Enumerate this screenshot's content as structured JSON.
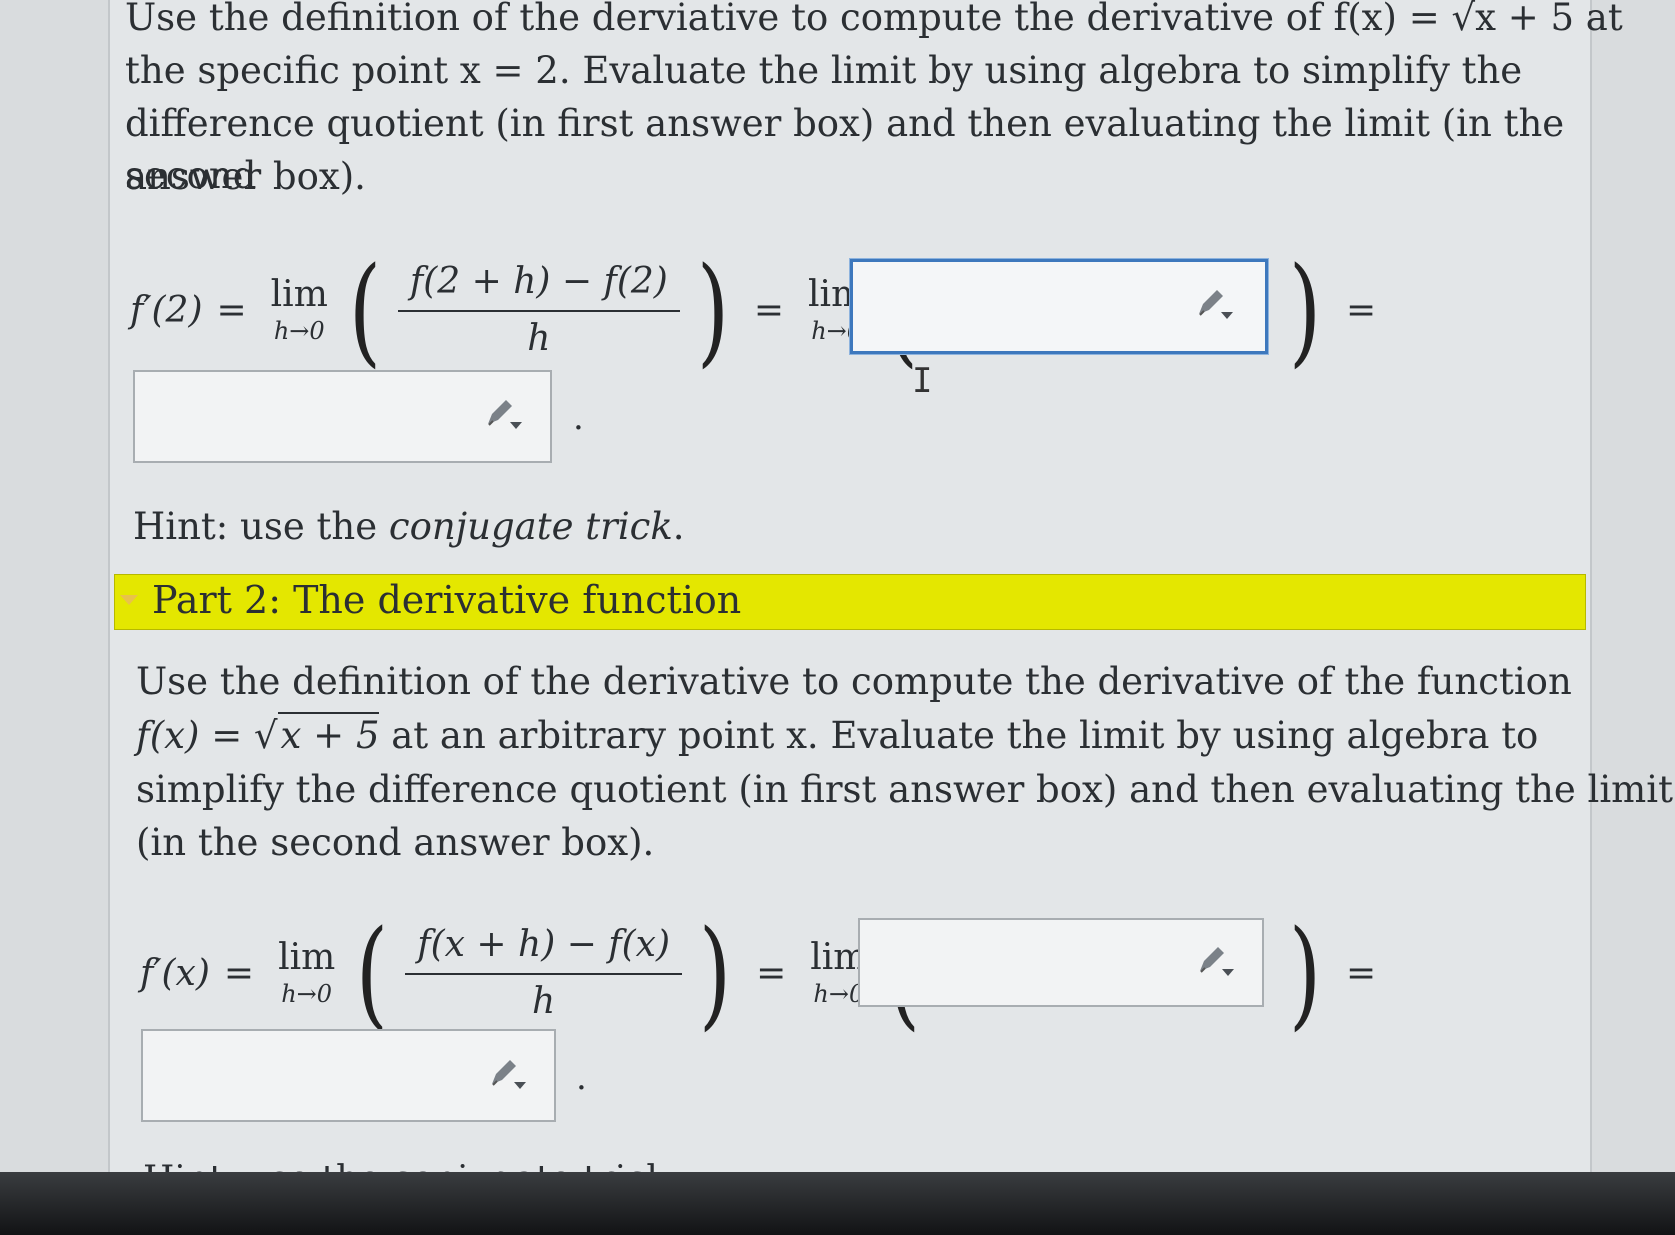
{
  "part1": {
    "para_lines": [
      "Use the definition of the derviative to compute the derivative of f(x) = √x + 5 at",
      "the specific point x = 2. Evaluate the limit by using algebra to simplify the",
      "difference quotient (in first answer box) and then evaluating the limit (in the second",
      "answer box)."
    ],
    "lhs": "f′(2)",
    "eq": "=",
    "lim": "lim",
    "sub": "h→0",
    "numerator": "f(2 + h) − f(2)",
    "denominator": "h",
    "end_period": ".",
    "hint_prefix": "Hint: use the ",
    "hint_emph": "conjugate trick",
    "hint_suffix": "."
  },
  "section2": {
    "title": "Part 2: The derivative function"
  },
  "part2": {
    "line1": "Use the definition of the derivative to compute the derivative of the function",
    "line2_fx": "f(x) = ",
    "line2_radicand": "x + 5",
    "line2_rest": " at an arbitrary point x. Evaluate the limit by using algebra to",
    "line3": "simplify the difference quotient (in first answer box) and then evaluating the limit",
    "line4": "(in the second answer box).",
    "lhs": "f′(x)",
    "eq": "=",
    "lim": "lim",
    "sub": "h→0",
    "numerator": "f(x + h) − f(x)",
    "denominator": "h",
    "end_period": ".",
    "cut_hint": "Hint: use the conjugate trick"
  },
  "icons": {
    "pencil": "pencil-dropdown-icon",
    "cursor": "text-cursor-icon"
  },
  "colors": {
    "section_bar": "#e4e700",
    "active_border": "#3d78bd"
  }
}
